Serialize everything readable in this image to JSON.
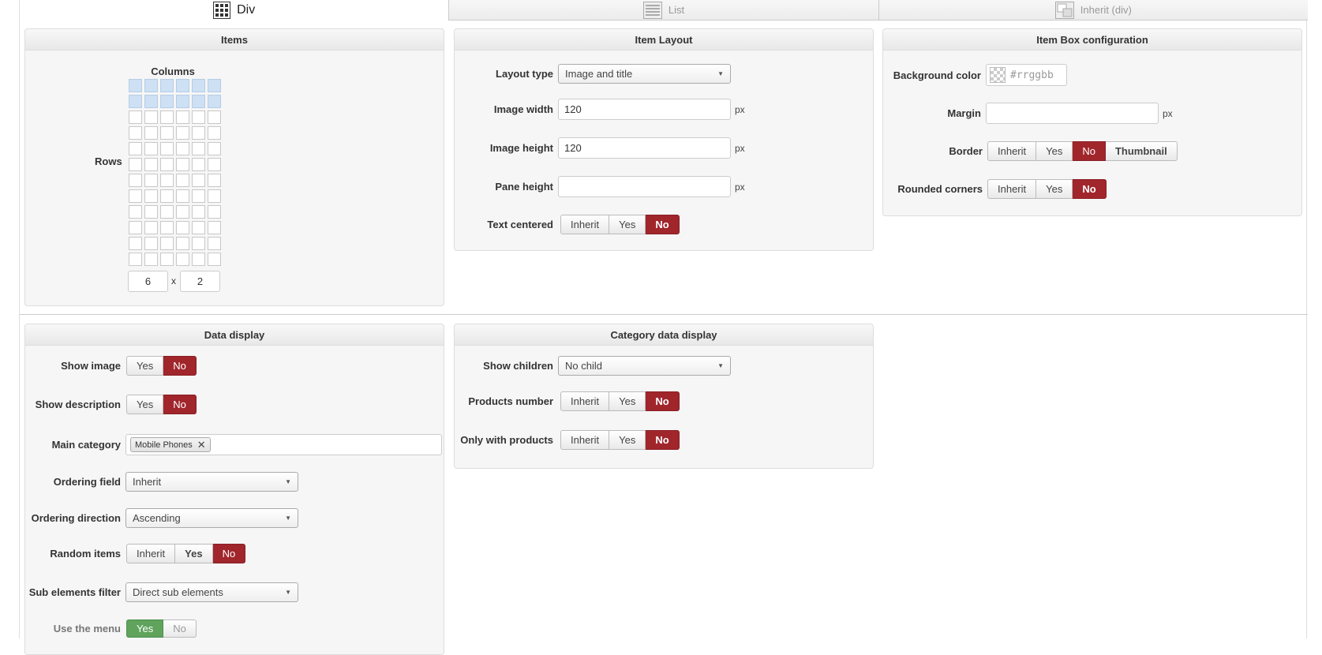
{
  "tabs": [
    {
      "label": "Div",
      "icon": "grid-icon",
      "active": true
    },
    {
      "label": "List",
      "icon": "list-icon",
      "active": false
    },
    {
      "label": "Inherit (div)",
      "icon": "inherit-icon",
      "active": false
    }
  ],
  "items": {
    "title": "Items",
    "columns_label": "Columns",
    "rows_label": "Rows",
    "grid_columns": 6,
    "grid_rows": 12,
    "selected_columns": 6,
    "selected_rows": 2,
    "columns_value": "6",
    "times": "x",
    "rows_value": "2"
  },
  "item_layout": {
    "title": "Item Layout",
    "layout_type_label": "Layout type",
    "layout_type_value": "Image and title",
    "image_width_label": "Image width",
    "image_width_value": "120",
    "image_height_label": "Image height",
    "image_height_value": "120",
    "pane_height_label": "Pane height",
    "pane_height_value": "",
    "unit": "px",
    "text_centered_label": "Text centered",
    "text_centered_options": [
      "Inherit",
      "Yes",
      "No"
    ]
  },
  "item_box": {
    "title": "Item Box configuration",
    "bg_color_label": "Background color",
    "bg_color_placeholder": "#rrggbb",
    "margin_label": "Margin",
    "margin_value": "",
    "unit": "px",
    "border_label": "Border",
    "border_options": [
      "Inherit",
      "Yes",
      "No",
      "Thumbnail"
    ],
    "rounded_label": "Rounded corners",
    "rounded_options": [
      "Inherit",
      "Yes",
      "No"
    ]
  },
  "data_display": {
    "title": "Data display",
    "show_image_label": "Show image",
    "show_image_options": [
      "Yes",
      "No"
    ],
    "show_desc_label": "Show description",
    "show_desc_options": [
      "Yes",
      "No"
    ],
    "main_category_label": "Main category",
    "main_category_tag": "Mobile Phones",
    "ordering_field_label": "Ordering field",
    "ordering_field_value": "Inherit",
    "ordering_dir_label": "Ordering direction",
    "ordering_dir_value": "Ascending",
    "random_label": "Random items",
    "random_options": [
      "Inherit",
      "Yes",
      "No"
    ],
    "sub_filter_label": "Sub elements filter",
    "sub_filter_value": "Direct sub elements",
    "use_menu_label": "Use the menu",
    "use_menu_options": [
      "Yes",
      "No"
    ]
  },
  "category_display": {
    "title": "Category data display",
    "show_children_label": "Show children",
    "show_children_value": "No child",
    "products_number_label": "Products number",
    "products_number_options": [
      "Inherit",
      "Yes",
      "No"
    ],
    "only_with_products_label": "Only with products",
    "only_with_products_options": [
      "Inherit",
      "Yes",
      "No"
    ]
  },
  "colors": {
    "active_red": "#a0262c",
    "active_green": "#5fa35c",
    "grid_selected": "#cde0f4"
  }
}
